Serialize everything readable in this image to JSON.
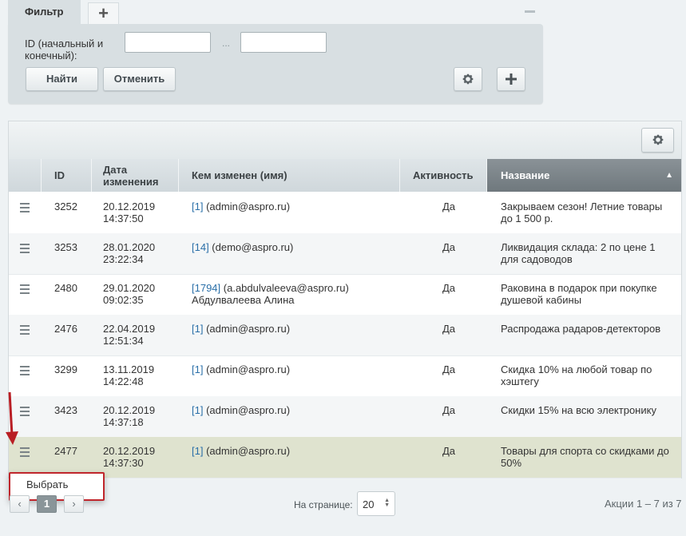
{
  "filter": {
    "tab_label": "Фильтр",
    "add_tab_icon": "plus-icon",
    "id_label": "ID (начальный и конечный):",
    "id_from_value": "",
    "id_to_value": "",
    "separator": "...",
    "find_label": "Найти",
    "cancel_label": "Отменить",
    "settings_icon": "gear-icon",
    "add_icon": "plus-icon"
  },
  "list": {
    "settings_icon": "gear-icon",
    "columns": {
      "id": "ID",
      "date": "Дата изменения",
      "modified_by": "Кем изменен (имя)",
      "active": "Активность",
      "name": "Название"
    },
    "sorted_column": "name",
    "sort_direction": "asc",
    "rows": [
      {
        "id": "3252",
        "date": "20.12.2019",
        "time": "14:37:50",
        "user_link": "[1]",
        "user": " (admin@aspro.ru)",
        "user_name": "",
        "active": "Да",
        "name": "Закрываем сезон! Летние товары до 1 500 р."
      },
      {
        "id": "3253",
        "date": "28.01.2020",
        "time": "23:22:34",
        "user_link": "[14]",
        "user": " (demo@aspro.ru)",
        "user_name": "",
        "active": "Да",
        "name": "Ликвидация склада: 2 по цене 1 для садоводов"
      },
      {
        "id": "2480",
        "date": "29.01.2020",
        "time": "09:02:35",
        "user_link": "[1794]",
        "user": " (a.abdulvaleeva@aspro.ru)",
        "user_name": "Абдулвалеева Алина",
        "active": "Да",
        "name": "Раковина в подарок при покупке душевой кабины"
      },
      {
        "id": "2476",
        "date": "22.04.2019",
        "time": "12:51:34",
        "user_link": "[1]",
        "user": " (admin@aspro.ru)",
        "user_name": "",
        "active": "Да",
        "name": "Распродажа радаров-детекторов"
      },
      {
        "id": "3299",
        "date": "13.11.2019",
        "time": "14:22:48",
        "user_link": "[1]",
        "user": " (admin@aspro.ru)",
        "user_name": "",
        "active": "Да",
        "name": "Скидка 10% на любой товар по хэштегу"
      },
      {
        "id": "3423",
        "date": "20.12.2019",
        "time": "14:37:18",
        "user_link": "[1]",
        "user": " (admin@aspro.ru)",
        "user_name": "",
        "active": "Да",
        "name": "Скидки 15% на всю электронику"
      },
      {
        "id": "2477",
        "date": "20.12.2019",
        "time": "14:37:30",
        "user_link": "[1]",
        "user": " (admin@aspro.ru)",
        "user_name": "",
        "active": "Да",
        "name": "Товары для спорта со скидками до 50%"
      }
    ],
    "highlighted_row": 6
  },
  "context_menu": {
    "select_label": "Выбрать"
  },
  "pagination": {
    "prev_icon": "chevron-left-icon",
    "current_page": "1",
    "next_icon": "chevron-right-icon",
    "per_page_label": "На странице:",
    "per_page_value": "20",
    "total_text": "Акции 1 – 7 из 7"
  },
  "colors": {
    "highlight_row": "#dfe3cf",
    "sorted_header": "#7a8388",
    "callout_border": "#c0262c",
    "link": "#2a6fa8"
  }
}
